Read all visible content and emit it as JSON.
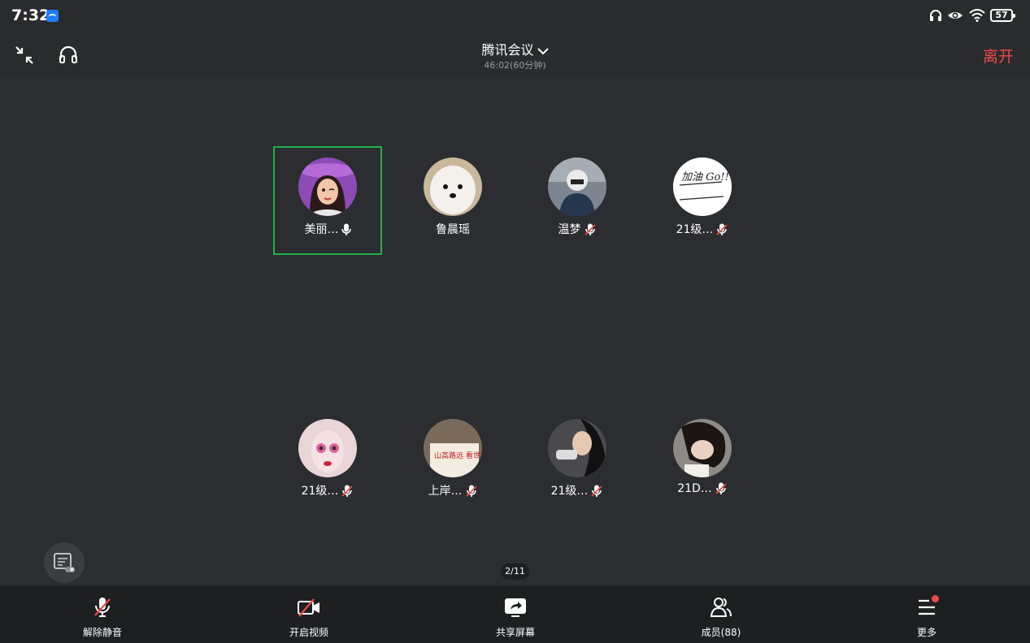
{
  "status_bar": {
    "time": "7:32",
    "battery": "57"
  },
  "meeting": {
    "title": "腾讯会议",
    "timer": "46:02(60分钟)",
    "leave_label": "离开"
  },
  "participants": [
    {
      "name": "美丽…",
      "mic": "mic-on-icon",
      "active": true
    },
    {
      "name": "鲁晨瑶",
      "mic": "",
      "active": false
    },
    {
      "name": "温梦",
      "mic": "mic-muted-icon",
      "active": false
    },
    {
      "name": "21级…",
      "mic": "mic-muted-icon",
      "active": false
    },
    {
      "name": "21级…",
      "mic": "mic-muted-icon",
      "active": false
    },
    {
      "name": "上岸…",
      "mic": "mic-muted-icon",
      "active": false
    },
    {
      "name": "21级…",
      "mic": "mic-muted-icon",
      "active": false
    },
    {
      "name": "21D…",
      "mic": "mic-muted-icon",
      "active": false
    }
  ],
  "avatar_text": {
    "p4": "加油 Go!!",
    "p6": "山高路远 看世界"
  },
  "pagination": {
    "text": "2/11"
  },
  "toolbar": {
    "unmute": "解除静音",
    "video": "开启视频",
    "share": "共享屏幕",
    "members": "成员(88)",
    "more": "更多"
  },
  "colors": {
    "leave": "#f04a4a",
    "active_border": "#22b14c",
    "background": "#2b2d30",
    "toolbar": "#1e1f21"
  }
}
